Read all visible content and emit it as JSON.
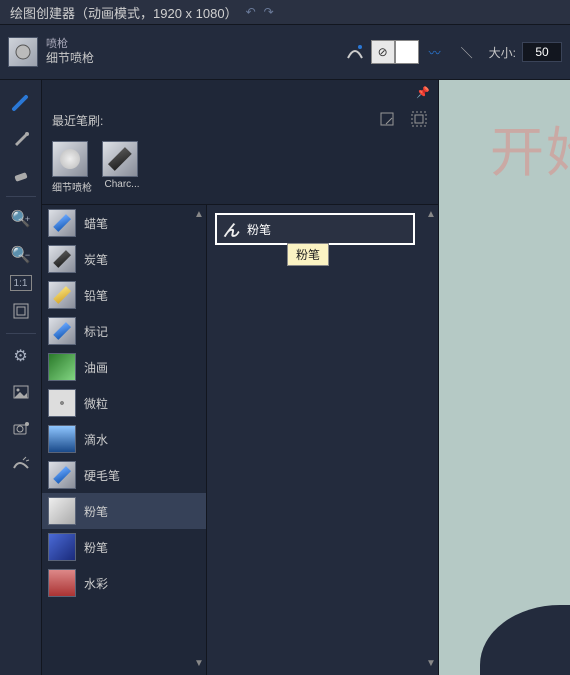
{
  "title": "绘图创建器（动画模式，1920 x 1080）",
  "toolbar": {
    "group": "喷枪",
    "name": "细节喷枪",
    "size_label": "大小:",
    "size_value": "50"
  },
  "panel": {
    "recent_label": "最近笔刷:",
    "recent_brushes": [
      {
        "label": "细节喷枪",
        "cls": "br-air"
      },
      {
        "label": "Charc...",
        "cls": "br-charcoal"
      }
    ]
  },
  "categories": [
    {
      "label": "蜡笔",
      "cls": "br-blue"
    },
    {
      "label": "炭笔",
      "cls": "br-charcoal"
    },
    {
      "label": "铅笔",
      "cls": "br-pencil"
    },
    {
      "label": "标记",
      "cls": "br-blue"
    },
    {
      "label": "油画",
      "cls": "br-oil"
    },
    {
      "label": "微粒",
      "cls": "br-grain"
    },
    {
      "label": "滴水",
      "cls": "br-drop"
    },
    {
      "label": "硬毛笔",
      "cls": "br-blue"
    },
    {
      "label": "粉笔",
      "cls": "br-chalk",
      "selected": true
    },
    {
      "label": "粉笔",
      "cls": "br-crystal"
    },
    {
      "label": "水彩",
      "cls": "br-water"
    }
  ],
  "preview": {
    "brush_label": "粉笔",
    "tooltip": "粉笔"
  },
  "canvas": {
    "watermark": "开始"
  }
}
